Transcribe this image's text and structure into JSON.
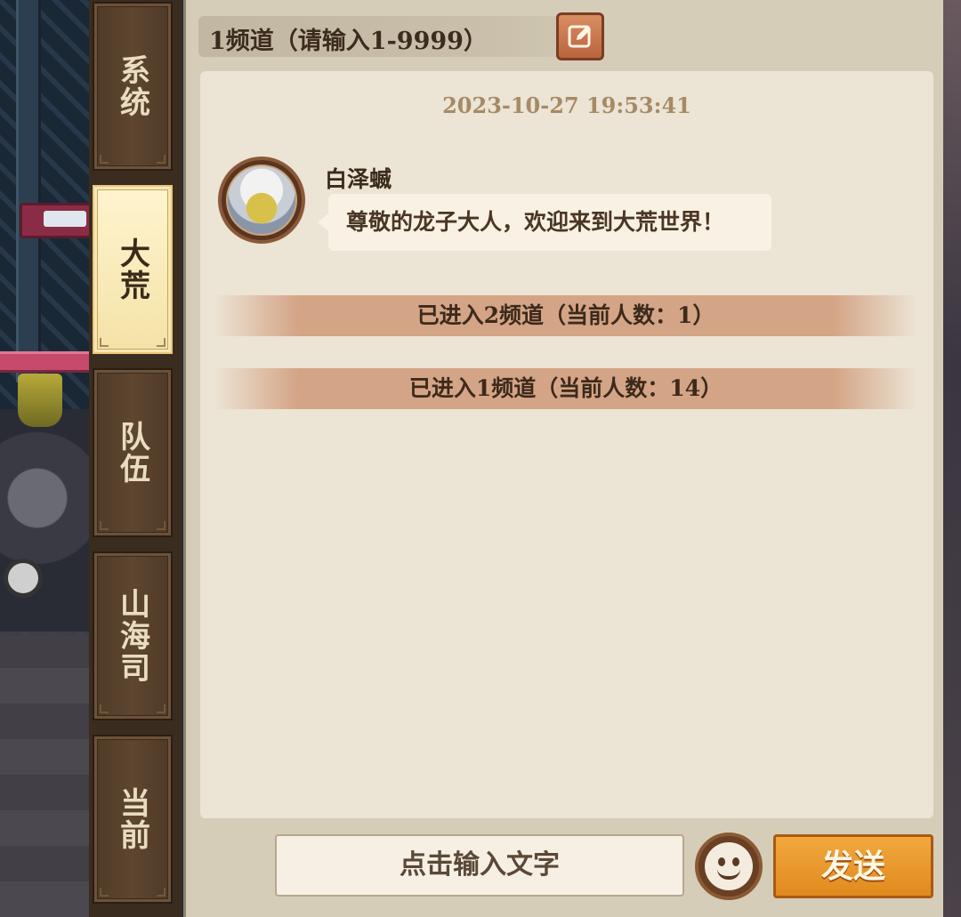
{
  "tabs": [
    {
      "label": "系统",
      "active": false
    },
    {
      "label": "大荒",
      "active": true
    },
    {
      "label": "队伍",
      "active": false
    },
    {
      "label": "山海司",
      "active": false
    },
    {
      "label": "当前",
      "active": false
    }
  ],
  "channel": {
    "label": "1频道（请输入1-9999）",
    "edit_icon": "edit-icon"
  },
  "chat": {
    "timestamp": "2023-10-27 19:53:41",
    "message": {
      "sender": "白泽蝛",
      "text": "尊敬的龙子大人，欢迎来到大荒世界！"
    },
    "system_lines": [
      "已进入2频道（当前人数：1）",
      "已进入1频道（当前人数：14）"
    ]
  },
  "composer": {
    "placeholder": "点击输入文字",
    "emoji_icon": "smiley-icon",
    "send_label": "发送"
  },
  "colors": {
    "panel": "#d6cdb9",
    "chat_bg": "#ece4d4",
    "send": "#e8951f",
    "tab_active": "#f4e2a6"
  }
}
